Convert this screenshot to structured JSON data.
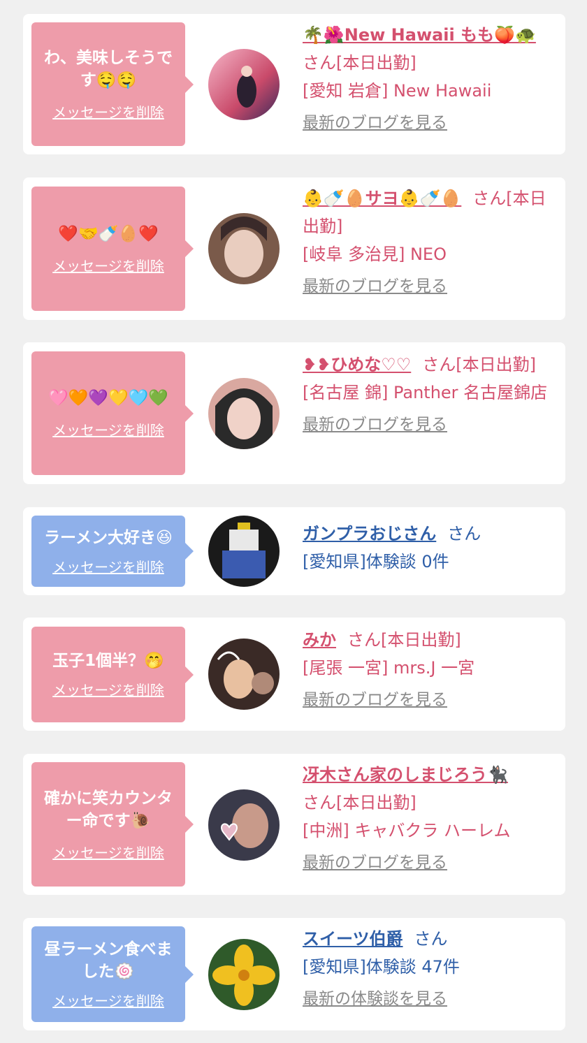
{
  "items": [
    {
      "message": "わ、美味しそうです🤤🤤",
      "delete_label": "メッセージを削除",
      "name": "🌴🌺New Hawaii もも🍑🐢",
      "suffix": "さん[本日出勤]",
      "location": "[愛知 岩倉] New Hawaii",
      "link": "最新のブログを見る",
      "theme": "pink",
      "avatar_colors": [
        "#c94a6a",
        "#f6b6c8",
        "#3b2a5a"
      ]
    },
    {
      "message": "❤️🤝🍼🥚❤️",
      "delete_label": "メッセージを削除",
      "name": "👶🍼🥚サヨ👶🍼🥚",
      "suffix": "さん[本日出勤]",
      "location": "[岐阜 多治見] NEO",
      "link": "最新のブログを見る",
      "theme": "pink",
      "avatar_colors": [
        "#7a5a4a",
        "#e9cdbf",
        "#3a2a2a"
      ]
    },
    {
      "message": "🩷🧡💜💛🩵💚",
      "delete_label": "メッセージを削除",
      "name": "❥❥ひめな♡♡",
      "suffix": "さん[本日出勤]",
      "location": "[名古屋 錦] Panther 名古屋錦店",
      "link": "最新のブログを見る",
      "theme": "pink",
      "avatar_colors": [
        "#2a2a2a",
        "#f0d2c8",
        "#d9a8a0"
      ]
    },
    {
      "message": "ラーメン大好き😆",
      "delete_label": "メッセージを削除",
      "name": "ガンプラおじさん",
      "suffix": "さん",
      "location": "[愛知県]体験談 0件",
      "link": "",
      "theme": "blue",
      "avatar_colors": [
        "#1a1a1a",
        "#e8e8e8",
        "#3b5bb0"
      ]
    },
    {
      "message": "玉子1個半？🤭",
      "delete_label": "メッセージを削除",
      "name": "みか",
      "suffix": "さん[本日出勤]",
      "location": "[尾張 一宮] mrs.J 一宮",
      "link": "最新のブログを見る",
      "theme": "pink",
      "avatar_colors": [
        "#3a2a26",
        "#b08a78",
        "#e8c0a0"
      ]
    },
    {
      "message": "確かに笑カウンター命です🐌",
      "delete_label": "メッセージを削除",
      "name": "冴木さん家のしまじろう🐈‍⬛",
      "suffix": "さん[本日出勤]",
      "location": "[中洲] キャバクラ ハーレム",
      "link": "最新のブログを見る",
      "theme": "pink",
      "avatar_colors": [
        "#3a3a4a",
        "#c89a8a",
        "#e6b8c8"
      ]
    },
    {
      "message": "昼ラーメン食べました🍥",
      "delete_label": "メッセージを削除",
      "name": "スイーツ伯爵",
      "suffix": "さん",
      "location": "[愛知県]体験談 47件",
      "link": "最新の体験談を見る",
      "theme": "blue",
      "avatar_colors": [
        "#2f5a2a",
        "#f0c020",
        "#6aa040"
      ]
    }
  ]
}
